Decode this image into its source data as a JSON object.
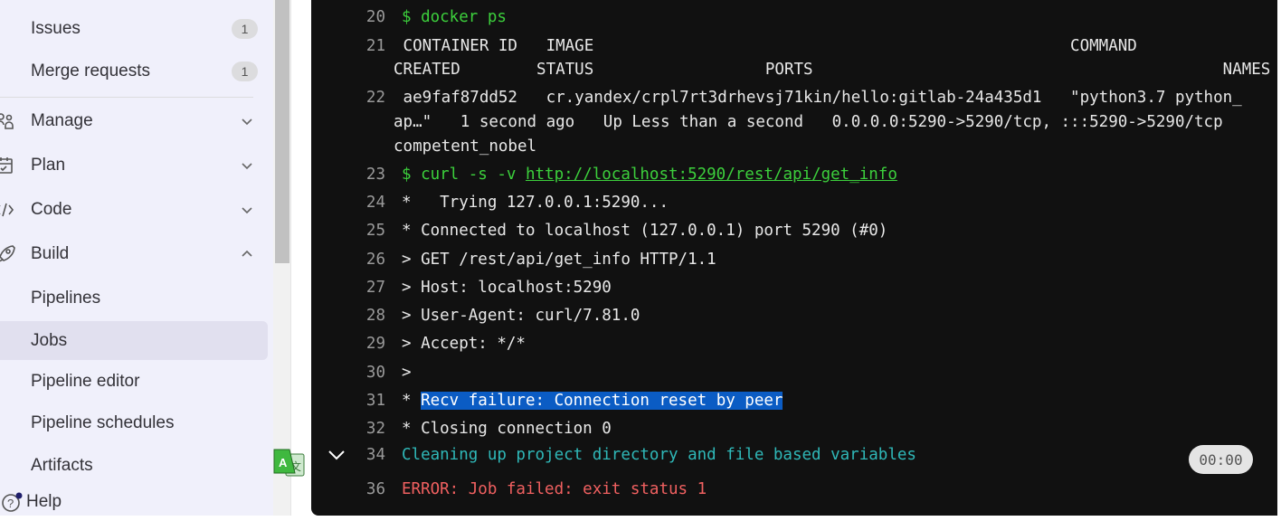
{
  "sidebar": {
    "items": [
      {
        "label": "Issues",
        "badge": "1"
      },
      {
        "label": "Merge requests",
        "badge": "1"
      },
      {
        "label": "Manage"
      },
      {
        "label": "Plan"
      },
      {
        "label": "Code"
      },
      {
        "label": "Build"
      },
      {
        "label": "Pipelines"
      },
      {
        "label": "Jobs",
        "selected": true
      },
      {
        "label": "Pipeline editor"
      },
      {
        "label": "Pipeline schedules"
      },
      {
        "label": "Artifacts"
      }
    ],
    "help": "Help"
  },
  "log": {
    "l20": {
      "n": "20",
      "t": "$ docker ps"
    },
    "l21": {
      "n": "21",
      "a": " CONTAINER ID   IMAGE                                                  COMMAND",
      "b": "CREATED        STATUS                  PORTS                                           NAMES"
    },
    "l22": {
      "n": "22",
      "a": " ae9faf87dd52   cr.yandex/crpl7rt3drhevsj71kin/hello:gitlab-24a435d1   \"python3.7 python_",
      "b": "ap…\"   1 second ago   Up Less than a second   0.0.0.0:5290->5290/tcp, :::5290->5290/tcp",
      "c": "competent_nobel"
    },
    "l23": {
      "n": "23",
      "t": "$ curl -s -v ",
      "url": "http://localhost:5290/rest/api/get_info"
    },
    "l24": {
      "n": "24",
      "t": "*   Trying 127.0.0.1:5290..."
    },
    "l25": {
      "n": "25",
      "t": "* Connected to localhost (127.0.0.1) port 5290 (#0)"
    },
    "l26": {
      "n": "26",
      "t": "> GET /rest/api/get_info HTTP/1.1"
    },
    "l27": {
      "n": "27",
      "t": "> Host: localhost:5290"
    },
    "l28": {
      "n": "28",
      "t": "> User-Agent: curl/7.81.0"
    },
    "l29": {
      "n": "29",
      "t": "> Accept: */*"
    },
    "l30": {
      "n": "30",
      "t": ">"
    },
    "l31": {
      "n": "31",
      "p": "* ",
      "t": "Recv failure: Connection reset by peer"
    },
    "l32": {
      "n": "32",
      "t": "* Closing connection 0"
    },
    "l34": {
      "n": "34",
      "t": "Cleaning up project directory and file based variables",
      "duration": "00:00"
    },
    "l36": {
      "n": "36",
      "t": "ERROR: Job failed: exit status 1"
    }
  },
  "colors": {
    "command": "#3ccf3c",
    "section": "#2fb8b8",
    "error": "#f06060",
    "highlight": "#0b5cc4"
  }
}
